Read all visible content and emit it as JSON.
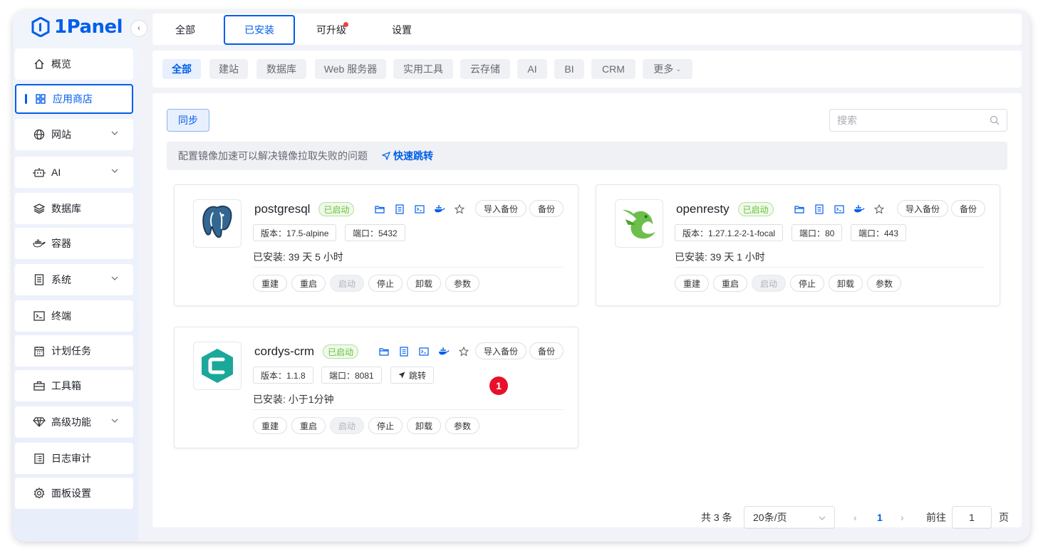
{
  "app": {
    "logo_text": "1Panel"
  },
  "sidebar": {
    "items": [
      {
        "label": "概览"
      },
      {
        "label": "应用商店"
      },
      {
        "label": "网站"
      },
      {
        "label": "AI"
      },
      {
        "label": "数据库"
      },
      {
        "label": "容器"
      },
      {
        "label": "系统"
      },
      {
        "label": "终端"
      },
      {
        "label": "计划任务"
      },
      {
        "label": "工具箱"
      },
      {
        "label": "高级功能"
      },
      {
        "label": "日志审计"
      },
      {
        "label": "面板设置"
      }
    ]
  },
  "tabs": {
    "all": "全部",
    "installed": "已安装",
    "upgradable": "可升级",
    "settings": "设置"
  },
  "categories": [
    "全部",
    "建站",
    "数据库",
    "Web 服务器",
    "实用工具",
    "云存储",
    "AI",
    "BI",
    "CRM",
    "更多"
  ],
  "toolbar": {
    "sync_label": "同步",
    "search_placeholder": "搜索"
  },
  "notice": {
    "text": "配置镜像加速可以解决镜像拉取失败的问题",
    "link": "快速跳转"
  },
  "apps": [
    {
      "name": "postgresql",
      "status": "已启动",
      "version": "版本：17.5-alpine",
      "port": "端口：5432",
      "installed": "已安装:  39 天 5 小时"
    },
    {
      "name": "openresty",
      "status": "已启动",
      "version": "版本：1.27.1.2-2-1-focal",
      "port": "端口：80",
      "port2": "端口：443",
      "installed": "已安装:  39 天 1 小时"
    },
    {
      "name": "cordys-crm",
      "status": "已启动",
      "version": "版本：1.1.8",
      "port": "端口：8081",
      "jump": "跳转",
      "installed": "已安装:  小于1分钟"
    }
  ],
  "card_actions": {
    "import_backup": "导入备份",
    "backup": "备份",
    "rebuild": "重建",
    "restart": "重启",
    "start": "启动",
    "stop": "停止",
    "uninstall": "卸载",
    "params": "参数"
  },
  "marker": "1",
  "pagination": {
    "total": "共 3 条",
    "page_size": "20条/页",
    "current_page": "1",
    "goto_label": "前往",
    "goto_value": "1",
    "page_suffix": "页"
  },
  "colors": {
    "accent": "#005eeb",
    "running_green": "#67c23a",
    "marker_red": "#e8102a"
  }
}
